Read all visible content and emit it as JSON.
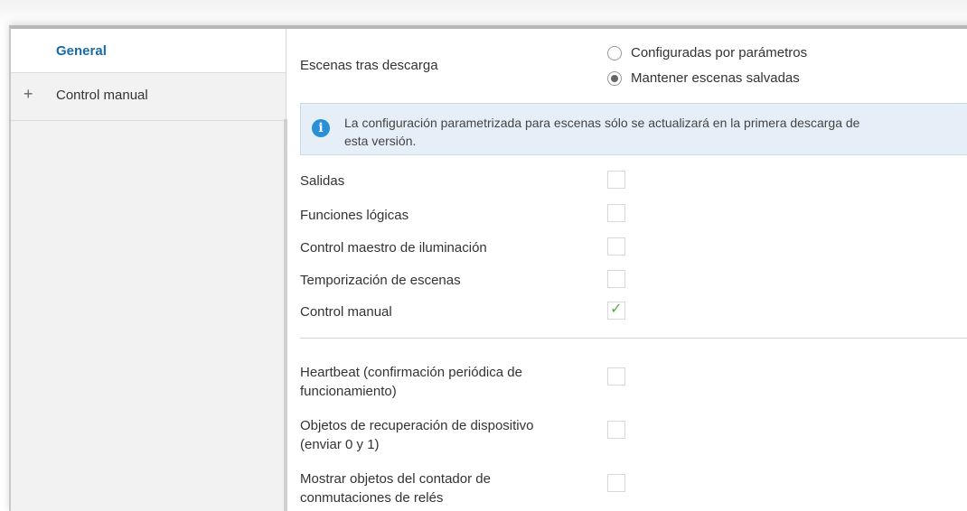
{
  "sidebar": {
    "items": [
      {
        "label": "General",
        "active": true
      },
      {
        "label": "Control manual",
        "expandable": "+"
      }
    ]
  },
  "scenes": {
    "label": "Escenas tras descarga",
    "options": [
      {
        "label": "Configuradas por parámetros",
        "checked": false
      },
      {
        "label": "Mantener escenas salvadas",
        "checked": true
      }
    ]
  },
  "info": {
    "icon": "info-icon",
    "line1": "La configuración parametrizada para escenas sólo se actualizará en la primera descarga de",
    "line2": "esta versión."
  },
  "functions": [
    {
      "label": "Salidas",
      "checked": false
    },
    {
      "label": "Funciones lógicas",
      "checked": false
    },
    {
      "label": "Control maestro de iluminación",
      "checked": false
    },
    {
      "label": "Temporización de escenas",
      "checked": false
    },
    {
      "label": "Control manual",
      "checked": true
    }
  ],
  "extras": [
    {
      "line1": "Heartbeat (confirmación periódica de",
      "line2": "funcionamiento)",
      "checked": false
    },
    {
      "line1": "Objetos de recuperación de dispositivo",
      "line2": "(enviar 0 y 1)",
      "checked": false
    },
    {
      "line1": "Mostrar objetos del contador de",
      "line2": "conmutaciones de relés",
      "checked": false
    }
  ],
  "colors": {
    "accent": "#1a6aa8",
    "info_bg": "#e6eff8",
    "check": "#5aa84c"
  }
}
